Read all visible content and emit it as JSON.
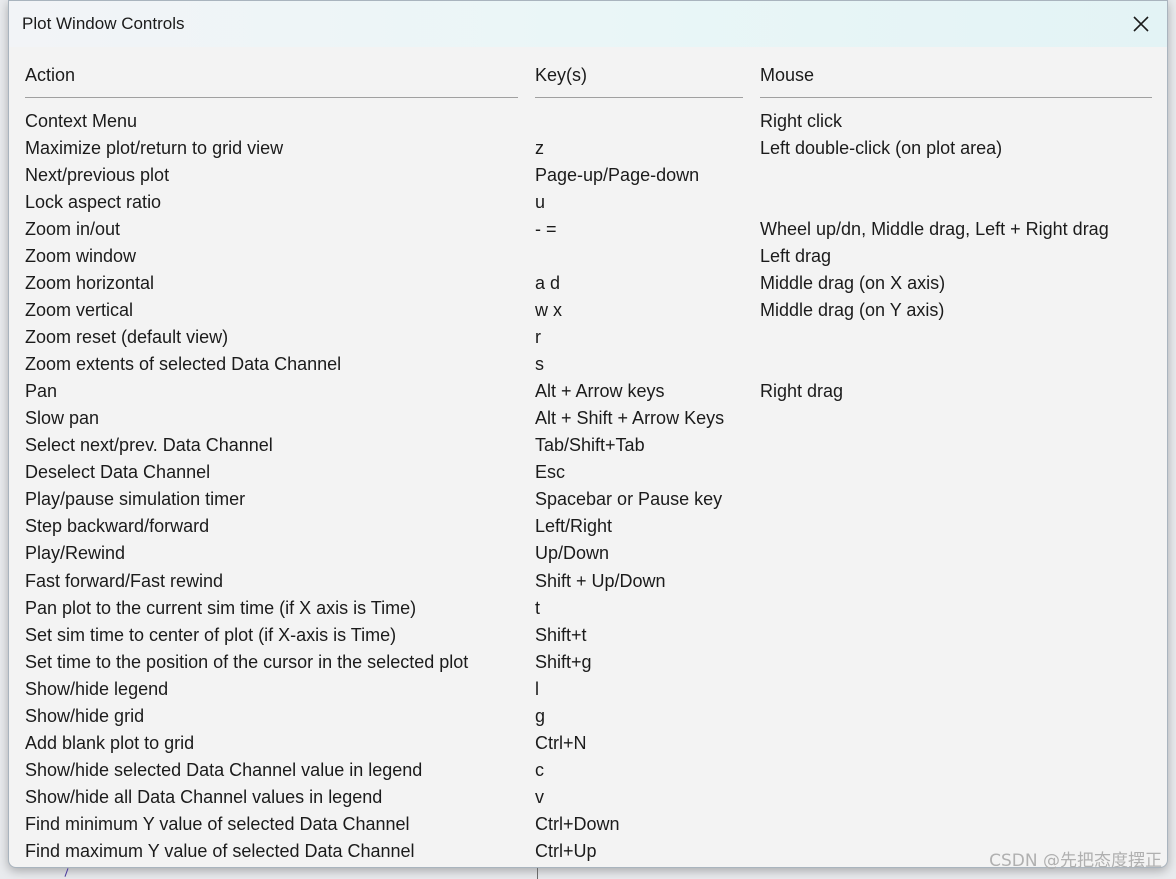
{
  "window": {
    "title": "Plot Window Controls",
    "close_icon": "close-icon"
  },
  "columns": {
    "action": "Action",
    "keys": "Key(s)",
    "mouse": "Mouse"
  },
  "rows": [
    {
      "action": "Context Menu",
      "keys": "",
      "mouse": "Right click"
    },
    {
      "action": "Maximize plot/return to grid view",
      "keys": "z",
      "mouse": "Left double-click (on plot area)"
    },
    {
      "action": "Next/previous plot",
      "keys": "Page-up/Page-down",
      "mouse": ""
    },
    {
      "action": "Lock aspect ratio",
      "keys": "u",
      "mouse": ""
    },
    {
      "action": "Zoom in/out",
      "keys": "- =",
      "mouse": "Wheel up/dn, Middle drag, Left + Right drag"
    },
    {
      "action": "Zoom window",
      "keys": "",
      "mouse": "Left drag"
    },
    {
      "action": "Zoom horizontal",
      "keys": "a d",
      "mouse": "Middle drag (on X axis)"
    },
    {
      "action": "Zoom vertical",
      "keys": "w x",
      "mouse": "Middle drag (on Y axis)"
    },
    {
      "action": "Zoom reset (default view)",
      "keys": "r",
      "mouse": ""
    },
    {
      "action": "Zoom extents of selected Data Channel",
      "keys": "s",
      "mouse": ""
    },
    {
      "action": "Pan",
      "keys": "Alt + Arrow keys",
      "mouse": "Right drag"
    },
    {
      "action": "Slow pan",
      "keys": "Alt + Shift + Arrow Keys",
      "mouse": ""
    },
    {
      "action": "Select next/prev. Data Channel",
      "keys": "Tab/Shift+Tab",
      "mouse": ""
    },
    {
      "action": "Deselect Data Channel",
      "keys": "Esc",
      "mouse": ""
    },
    {
      "action": "Play/pause simulation timer",
      "keys": "Spacebar or Pause key",
      "mouse": ""
    },
    {
      "action": "Step backward/forward",
      "keys": "Left/Right",
      "mouse": ""
    },
    {
      "action": "Play/Rewind",
      "keys": "Up/Down",
      "mouse": ""
    },
    {
      "action": "Fast forward/Fast rewind",
      "keys": "Shift + Up/Down",
      "mouse": ""
    },
    {
      "action": "Pan plot to the current sim time (if X axis is Time)",
      "keys": "t",
      "mouse": ""
    },
    {
      "action": "Set sim time to center of plot (if X-axis is Time)",
      "keys": "Shift+t",
      "mouse": ""
    },
    {
      "action": "Set time to the position of the cursor in the selected plot",
      "keys": "Shift+g",
      "mouse": ""
    },
    {
      "action": "Show/hide legend",
      "keys": "l",
      "mouse": ""
    },
    {
      "action": "Show/hide grid",
      "keys": "g",
      "mouse": ""
    },
    {
      "action": "Add blank plot to grid",
      "keys": "Ctrl+N",
      "mouse": ""
    },
    {
      "action": "Show/hide selected Data Channel value in legend",
      "keys": "c",
      "mouse": ""
    },
    {
      "action": "Show/hide all Data Channel values in legend",
      "keys": "v",
      "mouse": ""
    },
    {
      "action": "Find minimum Y value of selected Data Channel",
      "keys": "Ctrl+Down",
      "mouse": ""
    },
    {
      "action": "Find maximum Y value of selected Data Channel",
      "keys": "Ctrl+Up",
      "mouse": ""
    }
  ],
  "watermark": "CSDN @先把态度摆正"
}
